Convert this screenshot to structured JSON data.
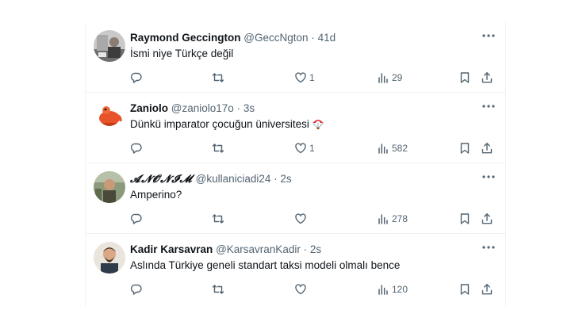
{
  "tweets": [
    {
      "name": "Raymond Geccington",
      "handle": "@GeccNgton",
      "separator": "·",
      "time": "41d",
      "text": "İsmi niye Türkçe değil",
      "replies": "",
      "retweets": "",
      "likes": "1",
      "views": "29"
    },
    {
      "name": "Zaniolo",
      "handle": "@zaniolo17o",
      "separator": "·",
      "time": "3s",
      "text": "Dünkü imparator çocuğun üniversitesi",
      "emoji": "parachute-emoji",
      "replies": "",
      "retweets": "",
      "likes": "1",
      "views": "582"
    },
    {
      "name": "𝓐𝓝𝓞𝓝𝓘𝓜",
      "handle": "@kullaniciadi24",
      "separator": "·",
      "time": "2s",
      "text": "Amperino?",
      "replies": "",
      "retweets": "",
      "likes": "",
      "views": "278"
    },
    {
      "name": "Kadir Karsavran",
      "handle": "@KarsavranKadir",
      "separator": "·",
      "time": "2s",
      "text": "Aslında Türkiye geneli standart taksi modeli olmalı bence",
      "replies": "",
      "retweets": "",
      "likes": "",
      "views": "120"
    }
  ],
  "icons": {
    "reply": "reply-icon",
    "retweet": "retweet-icon",
    "like": "heart-icon",
    "views": "views-icon",
    "bookmark": "bookmark-icon",
    "share": "share-icon",
    "more": "more-icon"
  },
  "colors": {
    "text": "#0f1419",
    "muted": "#536471",
    "divider": "#eff3f4",
    "emoji_red": "#e0313b"
  }
}
